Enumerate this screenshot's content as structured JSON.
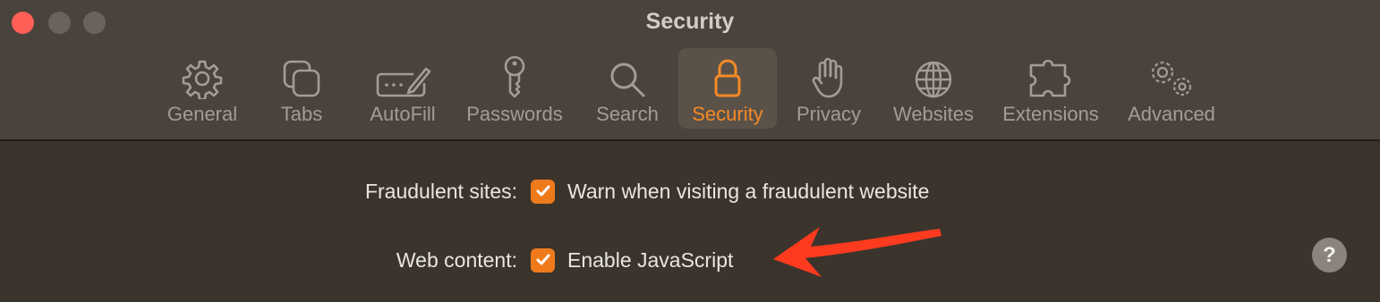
{
  "window": {
    "title": "Security"
  },
  "toolbar": {
    "items": [
      {
        "label": "General",
        "icon": "gear-icon"
      },
      {
        "label": "Tabs",
        "icon": "tabs-icon"
      },
      {
        "label": "AutoFill",
        "icon": "autofill-icon"
      },
      {
        "label": "Passwords",
        "icon": "key-icon"
      },
      {
        "label": "Search",
        "icon": "magnifier-icon"
      },
      {
        "label": "Security",
        "icon": "lock-icon",
        "selected": true
      },
      {
        "label": "Privacy",
        "icon": "hand-icon"
      },
      {
        "label": "Websites",
        "icon": "globe-icon"
      },
      {
        "label": "Extensions",
        "icon": "puzzle-icon"
      },
      {
        "label": "Advanced",
        "icon": "gears-icon"
      }
    ]
  },
  "settings": {
    "fraudulent": {
      "label": "Fraudulent sites:",
      "checkbox_text": "Warn when visiting a fraudulent website",
      "checked": true
    },
    "web_content": {
      "label": "Web content:",
      "checkbox_text": "Enable JavaScript",
      "checked": true
    }
  },
  "help": {
    "symbol": "?"
  },
  "colors": {
    "accent": "#f58a26",
    "annotation_arrow": "#ff3b1f",
    "close_button": "#fe5f57"
  }
}
